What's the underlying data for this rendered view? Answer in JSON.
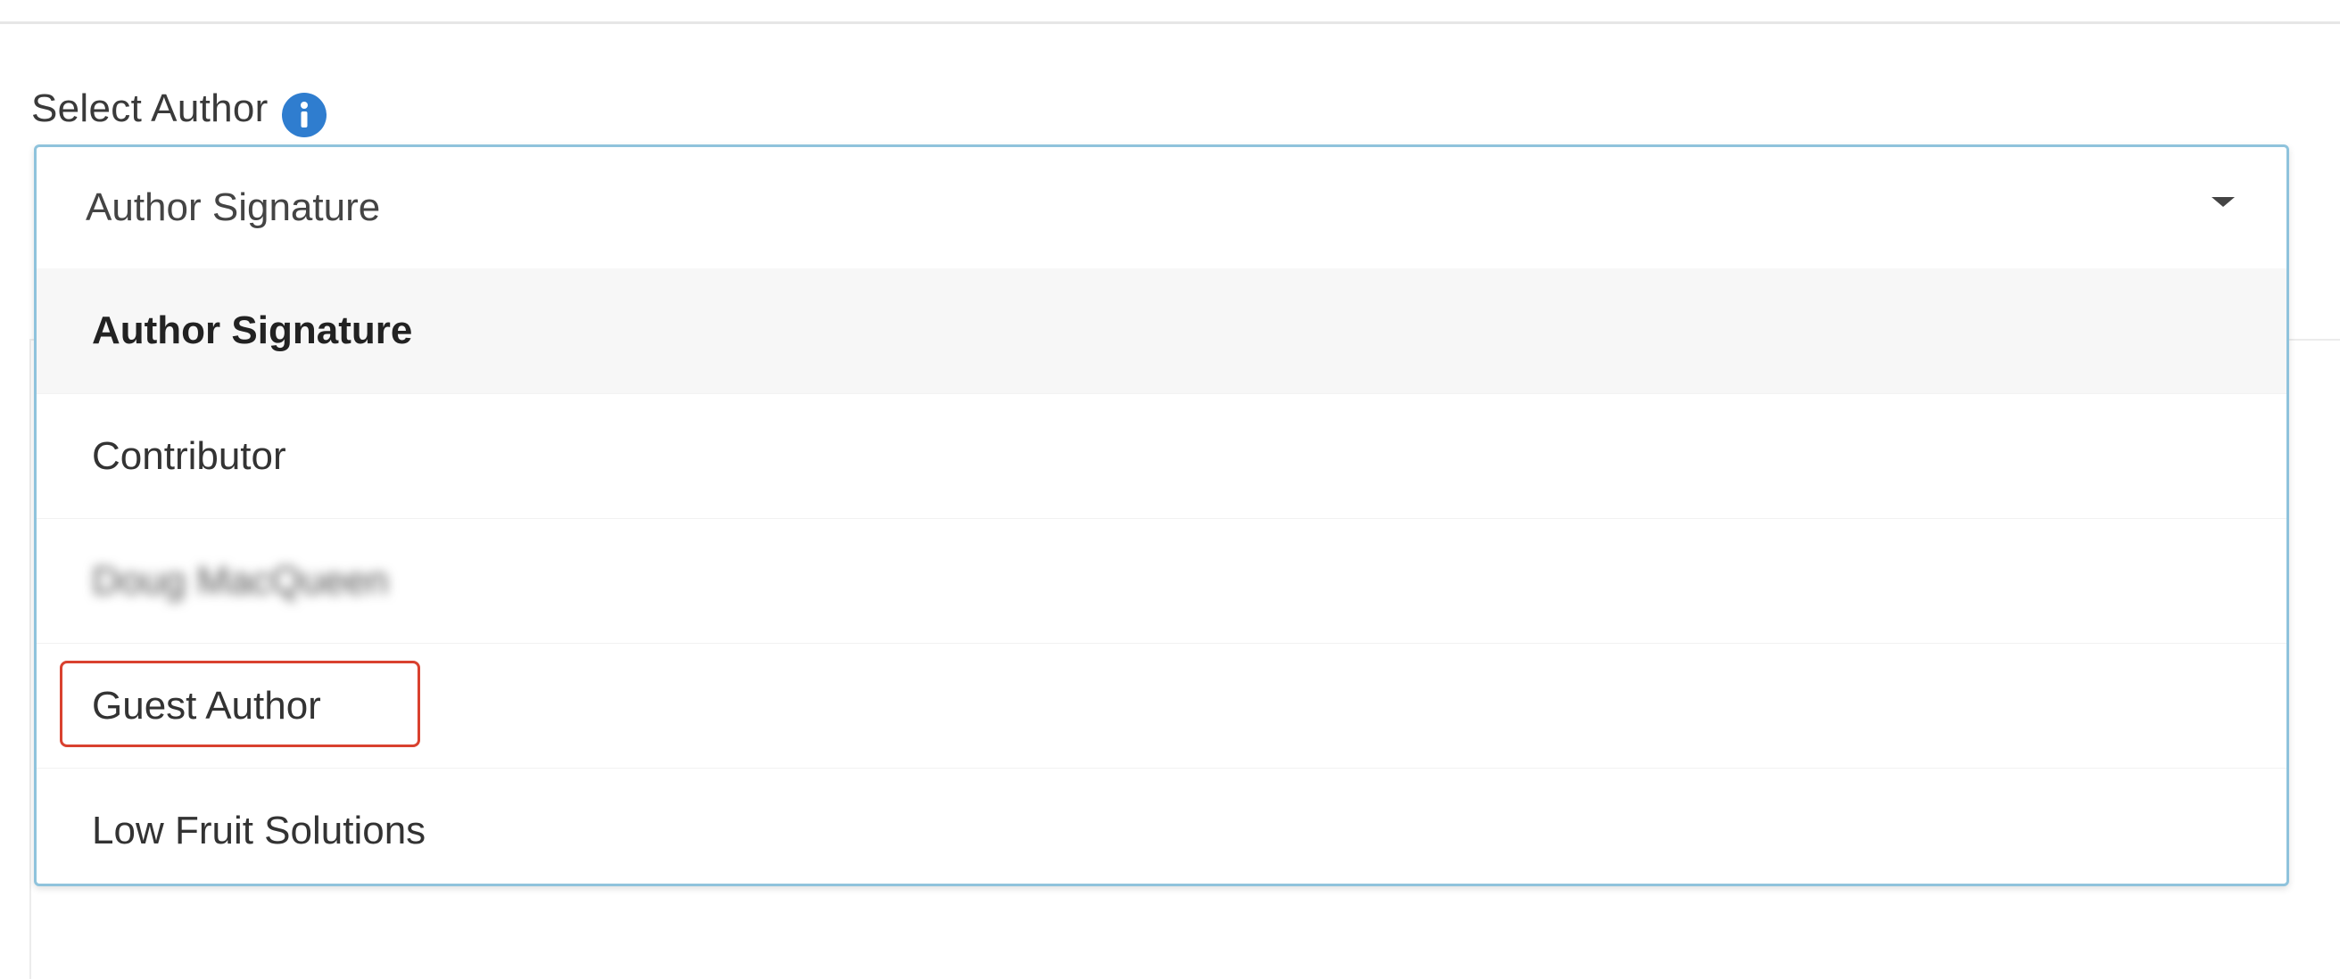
{
  "field": {
    "label": "Select Author",
    "info_icon": "info-icon",
    "selected_value": "Author Signature",
    "caret_icon": "caret-down-icon"
  },
  "options": [
    {
      "label": "Author Signature",
      "state": "highlighted"
    },
    {
      "label": "Contributor",
      "state": "normal"
    },
    {
      "label": "Doug MacQueen",
      "state": "blurred"
    },
    {
      "label": "Guest Author",
      "state": "annotated"
    },
    {
      "label": "Low Fruit Solutions",
      "state": "normal"
    }
  ],
  "colors": {
    "focus_border": "#8fc3dc",
    "info_icon": "#2f7dcf",
    "annotation": "#d9412f",
    "hover_bg": "#f7f7f7"
  }
}
